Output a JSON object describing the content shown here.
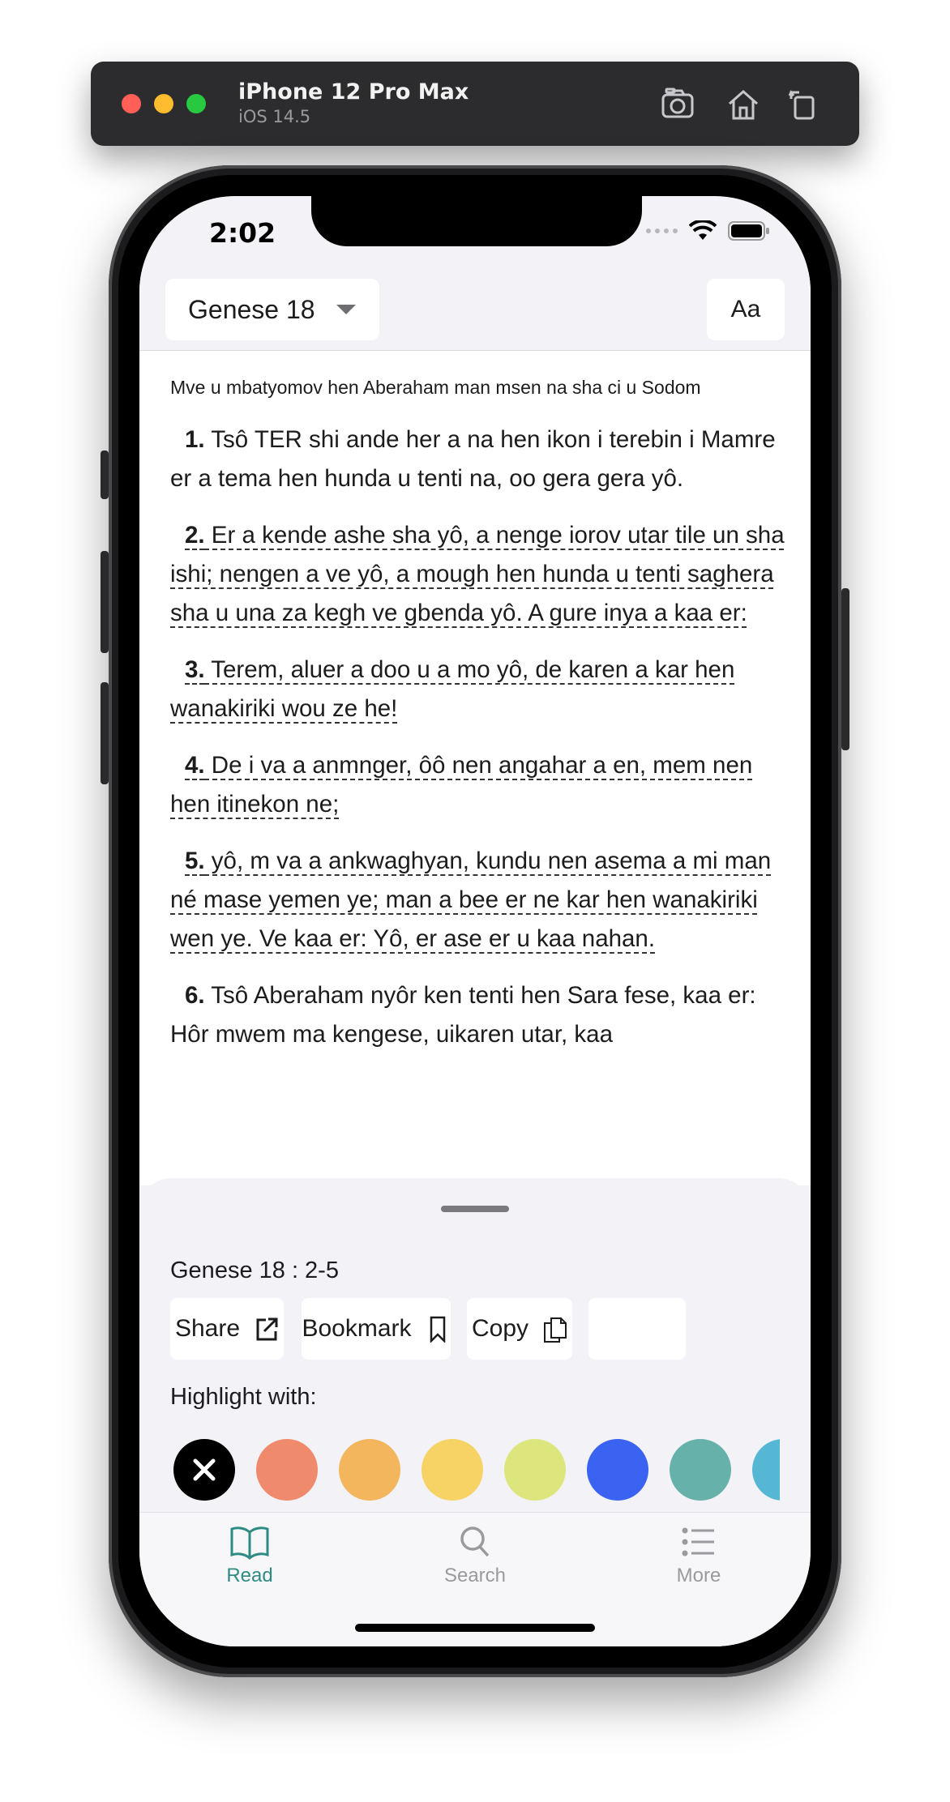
{
  "simulator": {
    "device": "iPhone 12 Pro Max",
    "os": "iOS 14.5",
    "icons": [
      "screenshot-icon",
      "home-icon",
      "rotate-icon"
    ]
  },
  "status_bar": {
    "time": "2:02"
  },
  "header": {
    "book_chapter": "Genese 18",
    "font_button": "Aa"
  },
  "reader": {
    "section_heading": "Mve u mbatyomov hen Aberaham man msen na sha ci u Sodom",
    "verses": [
      {
        "num": "1.",
        "text": " Tsô TER shi ande her a na hen ikon i terebin i Mamre er a tema hen hunda u tenti na, oo gera gera yô.",
        "selected": false
      },
      {
        "num": "2.",
        "text": " Er a kende ashe sha yô, a nenge iorov utar tile un sha ishi; nengen a ve yô, a mough hen hunda u tenti saghera sha u una za kegh ve gbenda yô. A gure inya a kaa er:",
        "selected": true
      },
      {
        "num": "3.",
        "text": " Terem, aluer a doo u a mo yô, de karen a kar hen wanakiriki wou ze he!",
        "selected": true
      },
      {
        "num": "4.",
        "text": " De i va a anmnger, ôô nen angahar a en, mem nen hen itinekon ne;",
        "selected": true
      },
      {
        "num": "5.",
        "text": " yô, m va a ankwaghyan, kundu nen asema a mi man né mase yemen ye; man a bee er ne kar hen wanakiriki wen ye. Ve kaa er: Yô, er ase er u kaa nahan.",
        "selected": true
      },
      {
        "num": "6.",
        "text": " Tsô Aberaham nyôr ken tenti hen Sara fese, kaa er: Hôr mwem ma kengese, uikaren utar, kaa",
        "selected": false
      }
    ]
  },
  "sheet": {
    "reference": "Genese 18 : 2-5",
    "actions": [
      {
        "label": "Share",
        "icon": "share-icon"
      },
      {
        "label": "Bookmark",
        "icon": "bookmark-icon"
      },
      {
        "label": "Copy",
        "icon": "copy-icon"
      }
    ],
    "highlight_label": "Highlight with:",
    "colors": [
      "#000000",
      "#ef8a6c",
      "#f3b65c",
      "#f7d365",
      "#dde67c",
      "#3a63f2",
      "#66b2aa",
      "#55b7d4"
    ]
  },
  "tabbar": {
    "tabs": [
      {
        "label": "Read",
        "icon": "book-icon",
        "active": true
      },
      {
        "label": "Search",
        "icon": "search-icon",
        "active": false
      },
      {
        "label": "More",
        "icon": "list-icon",
        "active": false
      }
    ],
    "active_color": "#2e8b84",
    "inactive_color": "#9a9a9e"
  }
}
